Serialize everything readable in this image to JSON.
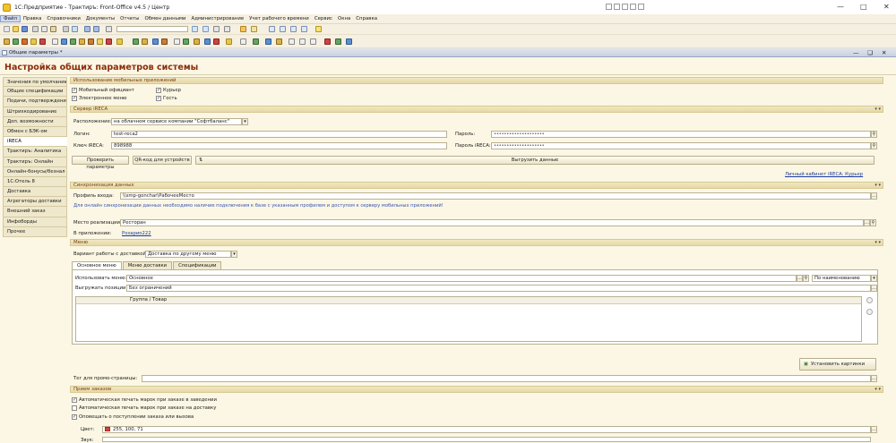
{
  "app": {
    "title": "1С:Предприятие - Трактиръ: Front-Office v4.5 / Центр"
  },
  "menu": [
    "Файл",
    "Правка",
    "Справочники",
    "Документы",
    "Отчеты",
    "Обмен данными",
    "Администрирование",
    "Учет рабочего времени",
    "Сервис",
    "Окна",
    "Справка"
  ],
  "window": {
    "title": "Общие параметры *"
  },
  "form": {
    "heading": "Настройка общих параметров системы"
  },
  "sidebar": [
    "Значения по умолчанию",
    "Общие спецификации",
    "Подачи, подтверждения",
    "Штрихкодирование",
    "Доп. возможности",
    "Обмен с БЭК-ом",
    "iRECA",
    "Трактиръ: Аналитика",
    "Трактиръ: Онлайн",
    "Онлайн-бонусы/безнал",
    "1С:Отель 8",
    "Доставка",
    "Агрегаторы доставки",
    "Внешний заказ",
    "Инфоборды",
    "Прочее"
  ],
  "mobile": {
    "section": "Использование мобильных приложений",
    "opt1": "Мобильный официант",
    "opt2": "Электронное меню",
    "opt3": "Курьер",
    "opt4": "Гость"
  },
  "ireca": {
    "section": "Сервер iRECA",
    "location_label": "Расположение:",
    "location_value": "на облачном сервисе компании \"Софтбаланс\"",
    "login_label": "Логин:",
    "login_value": "test-reca2",
    "password_label": "Пароль:",
    "password_value": "••••••••••••••••••••",
    "key_label": "Ключ iRECA:",
    "key_value": "898988",
    "key_password_label": "Пароль iRECA:",
    "key_password_value": "••••••••••••••••••••",
    "check_btn": "Проверить параметры",
    "qr_btn": "QR-код для устройств",
    "upload_btn": "Выгрузить данные",
    "cabinet_link": "Личный кабинет iRECA: Курьер"
  },
  "sync": {
    "section": "Синхронизация данных",
    "profile_label": "Профиль входа:",
    "profile_value": "\\\\smp-gonchar\\РабочееМесто",
    "hint": "Для онлайн синхронизации данных необходимо наличие подключения к базе с указанным профилем и доступом к серверу мобильных приложений!",
    "place_label": "Место реализации:",
    "place_value": "Ресторан",
    "app_label": "В приложении:",
    "app_link": "Розарио222"
  },
  "menu_section": {
    "section": "Меню",
    "variant_label": "Вариант работы с доставкой:",
    "variant_value": "Доставка по другому меню",
    "tabs": [
      "Основное меню",
      "Меню доставки",
      "Спецификации"
    ],
    "use_menu_label": "Использовать меню:",
    "use_menu_value": "Основное",
    "sort_value": "По наименованию",
    "export_label": "Выгружать позиции:",
    "export_value": "Без ограничений",
    "grid_col": "Группа / Товар",
    "set_images_btn": "Установить картинки",
    "promo_label": "Тег для промо-страницы:"
  },
  "orders": {
    "section": "Прием заказов",
    "opt1": "Автоматическая печать марок при заказе в заведении",
    "opt2": "Автоматическая печать марок при заказе на доставку",
    "opt3": "Оповещать о поступлении заказа или вызова",
    "color_label": "Цвет:",
    "color_value": "255, 100, 71",
    "sound_label": "Звук:"
  },
  "colors": {
    "heading": "#8b2b0a",
    "link": "#1a3a9c",
    "section": "#7b3c12"
  }
}
